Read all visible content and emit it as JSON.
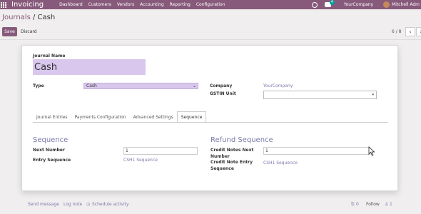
{
  "navbar": {
    "brand": "Invoicing",
    "menu": [
      "Dashboard",
      "Customers",
      "Vendors",
      "Accounting",
      "Reporting",
      "Configuration"
    ],
    "chat_badge": "4",
    "company": "YourCompany",
    "user": "Mitchell Adm"
  },
  "breadcrumb": {
    "parent": "Journals",
    "separator": "/",
    "current": "Cash"
  },
  "buttons": {
    "save": "Save",
    "discard": "Discard"
  },
  "pager": {
    "value": "6 / 8",
    "prev": "‹",
    "next": "›"
  },
  "form": {
    "journal_name_label": "Journal Name",
    "journal_name": "Cash",
    "type_label": "Type",
    "type_value": "Cash",
    "company_label": "Company",
    "company_value": "YourCompany",
    "gstin_label": "GSTIN Unit",
    "gstin_value": ""
  },
  "tabs": [
    "Journal Entries",
    "Payments Configuration",
    "Advanced Settings",
    "Sequence"
  ],
  "active_tab": "Sequence",
  "sequence": {
    "title": "Sequence",
    "next_number_label": "Next Number",
    "next_number": "1",
    "entry_sequence_label": "Entry Sequence",
    "entry_sequence": "CSH1 Sequence"
  },
  "refund": {
    "title": "Refund Sequence",
    "next_label_1": "Credit Notes Next",
    "next_label_2": "Number",
    "next_number": "1",
    "entry_label_1": "Credit Note Entry",
    "entry_label_2": "Sequence",
    "entry_sequence": "CSH1 Sequence"
  },
  "chatter": {
    "send_message": "Send message",
    "log_note": "Log note",
    "schedule_activity": "Schedule activity",
    "attachments": "0",
    "follow": "Follow",
    "followers": "1"
  },
  "colors": {
    "brand": "#875a7b",
    "link": "#7c7bad",
    "highlight": "#d9c7ed"
  }
}
